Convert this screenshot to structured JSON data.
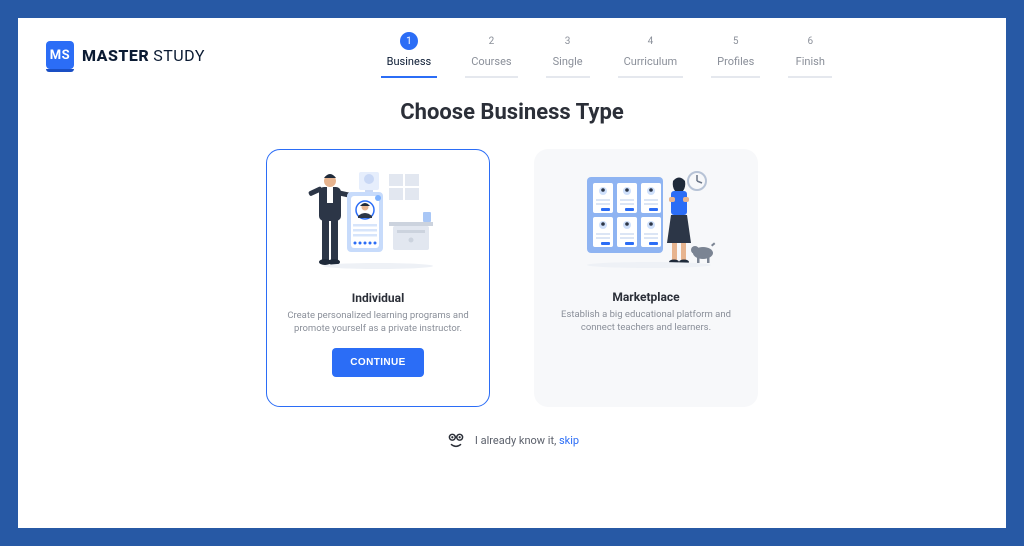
{
  "brand": {
    "mark": "MS",
    "name_bold": "MASTER",
    "name_light": "STUDY"
  },
  "stepper": [
    {
      "num": "1",
      "label": "Business",
      "active": true
    },
    {
      "num": "2",
      "label": "Courses",
      "active": false
    },
    {
      "num": "3",
      "label": "Single",
      "active": false
    },
    {
      "num": "4",
      "label": "Curriculum",
      "active": false
    },
    {
      "num": "5",
      "label": "Profiles",
      "active": false
    },
    {
      "num": "6",
      "label": "Finish",
      "active": false
    }
  ],
  "page_title": "Choose Business Type",
  "options": {
    "individual": {
      "title": "Individual",
      "desc": "Create personalized learning programs and promote yourself as a private instructor.",
      "cta": "CONTINUE",
      "selected": true
    },
    "marketplace": {
      "title": "Marketplace",
      "desc": "Establish a big educational platform and connect teachers and learners.",
      "selected": false
    }
  },
  "skip": {
    "prefix": "I already know it, ",
    "link": "skip"
  }
}
